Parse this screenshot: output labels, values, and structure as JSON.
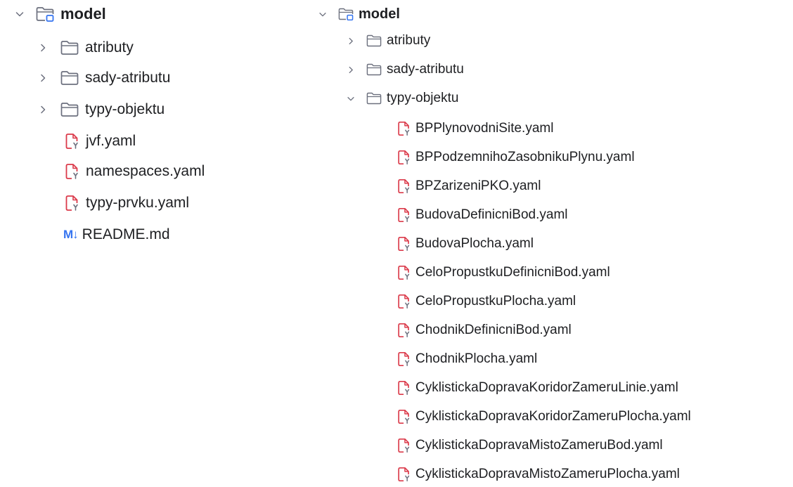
{
  "left_tree": {
    "root": {
      "label": "model",
      "expanded": true
    },
    "folders": [
      {
        "label": "atributy",
        "expanded": false
      },
      {
        "label": "sady-atributu",
        "expanded": false
      },
      {
        "label": "typy-objektu",
        "expanded": false
      }
    ],
    "files": [
      {
        "label": "jvf.yaml",
        "icon": "yaml-file-icon"
      },
      {
        "label": "namespaces.yaml",
        "icon": "yaml-file-icon"
      },
      {
        "label": "typy-prvku.yaml",
        "icon": "yaml-file-icon"
      },
      {
        "label": "README.md",
        "icon": "markdown-file-icon",
        "icon_text": "M↓"
      }
    ]
  },
  "right_tree": {
    "root": {
      "label": "model",
      "expanded": true
    },
    "folders": [
      {
        "label": "atributy",
        "expanded": false
      },
      {
        "label": "sady-atributu",
        "expanded": false
      },
      {
        "label": "typy-objektu",
        "expanded": true
      }
    ],
    "files": [
      "BPPlynovodniSite.yaml",
      "BPPodzemnihoZasobnikuPlynu.yaml",
      "BPZarizeniPKO.yaml",
      "BudovaDefinicniBod.yaml",
      "BudovaPlocha.yaml",
      "CeloPropustkuDefinicniBod.yaml",
      "CeloPropustkuPlocha.yaml",
      "ChodnikDefinicniBod.yaml",
      "ChodnikPlocha.yaml",
      "CyklistickaDopravaKoridorZameruLinie.yaml",
      "CyklistickaDopravaKoridorZameruPlocha.yaml",
      "CyklistickaDopravaMistoZameruBod.yaml",
      "CyklistickaDopravaMistoZameruPlocha.yaml"
    ]
  },
  "colors": {
    "text": "#1e1f22",
    "chevron": "#6c707e",
    "folder_outline": "#6c707e",
    "module_accent": "#3574f0",
    "yaml_icon": "#db3b4b",
    "yaml_badge": "#6c707e",
    "markdown_icon": "#3574f0"
  }
}
